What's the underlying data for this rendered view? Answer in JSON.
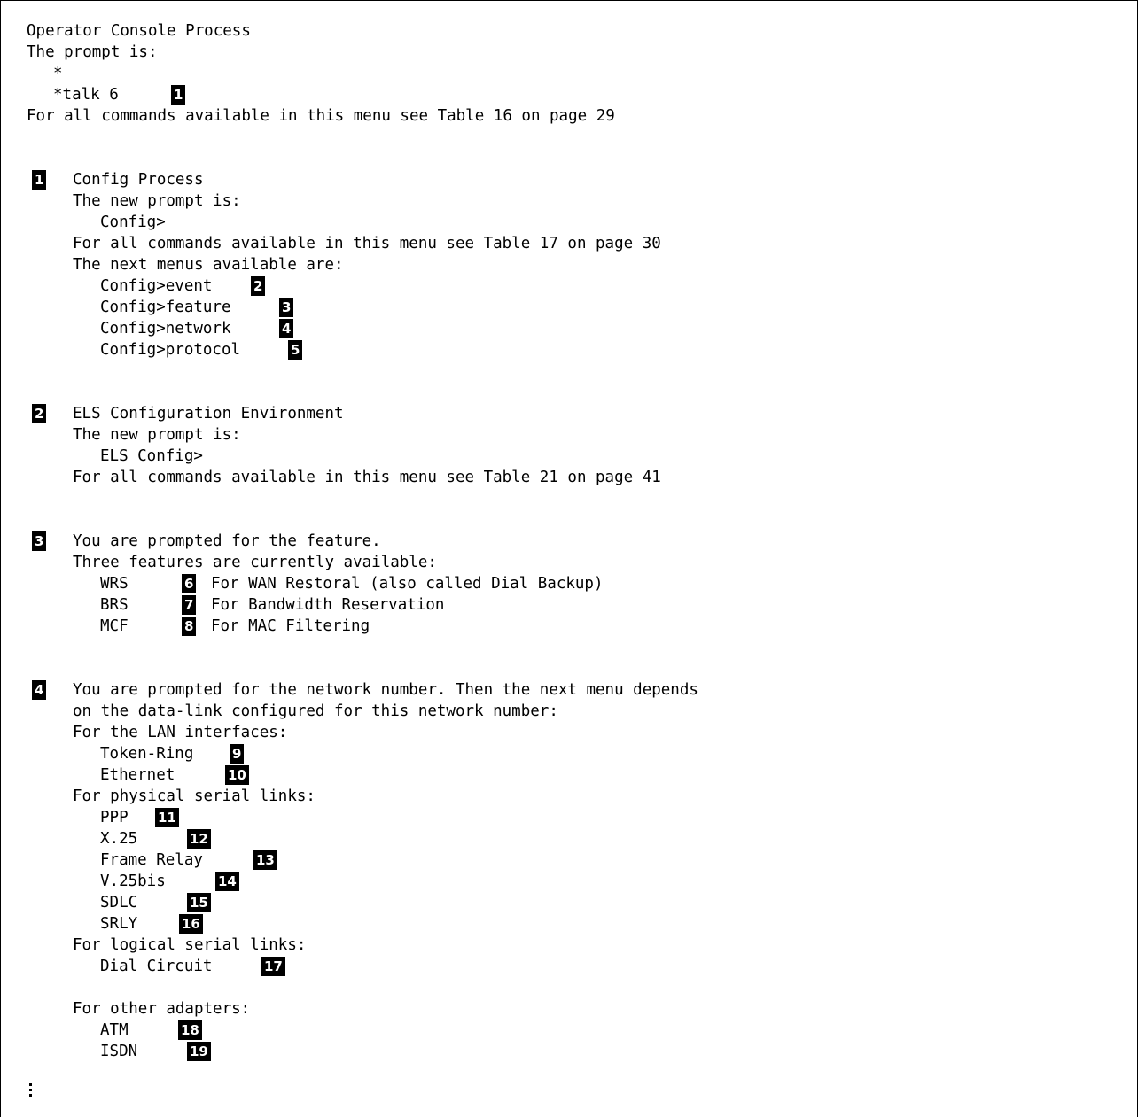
{
  "lines": [
    "Operator Console Process",
    "The prompt is:",
    "*",
    "*talk 6",
    "For all commands available in this menu see Table 16 on page 29",
    "Config Process",
    "The new prompt is:",
    "Config>",
    "For all commands available in this menu see Table 17 on page 30",
    "The next menus available are:",
    "Config>event",
    "Config>feature",
    "Config>network",
    "Config>protocol",
    "ELS Configuration Environment",
    "The new prompt is:",
    "ELS Config>",
    "For all commands available in this menu see Table 21 on page 41",
    "You are prompted for the feature.",
    "Three features are currently available:",
    "WRS",
    "For WAN Restoral (also called Dial Backup)",
    "BRS",
    "For Bandwidth Reservation",
    "MCF",
    "For MAC Filtering",
    "You are prompted for the network number. Then the next menu depends",
    "on the data-link configured for this network number:",
    "For the LAN interfaces:",
    "Token-Ring",
    "Ethernet",
    "For physical serial links:",
    "PPP",
    "X.25",
    "Frame Relay",
    "V.25bis",
    "SDLC",
    "SRLY",
    "For logical serial links:",
    "Dial Circuit",
    "For other adapters:",
    "ATM",
    "ISDN"
  ],
  "badges": [
    "1",
    "1",
    "2",
    "3",
    "4",
    "5",
    "2",
    "3",
    "6",
    "7",
    "8",
    "4",
    "9",
    "10",
    "11",
    "12",
    "13",
    "14",
    "15",
    "16",
    "17",
    "18",
    "19"
  ]
}
